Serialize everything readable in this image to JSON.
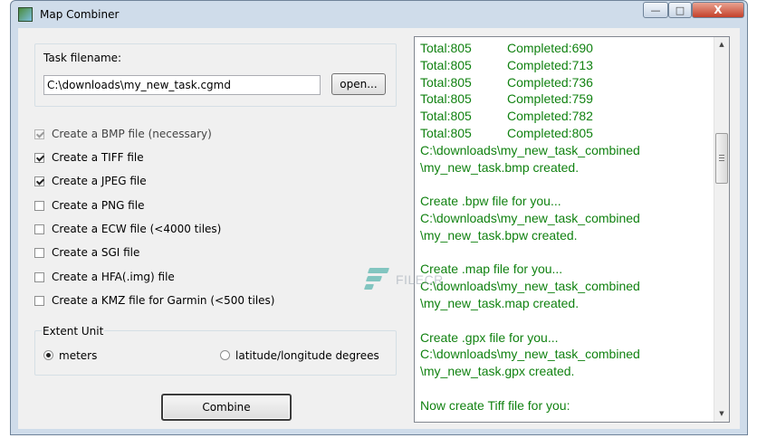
{
  "window": {
    "title": "Map Combiner",
    "controls": {
      "minimize": "—",
      "maximize": "□",
      "close": "X"
    }
  },
  "task": {
    "label": "Task filename:",
    "value": "C:\\downloads\\my_new_task.cgmd",
    "open_label": "open..."
  },
  "options": [
    {
      "label": "Create a BMP file (necessary)",
      "checked": true,
      "disabled": true
    },
    {
      "label": "Create a  TIFF file",
      "checked": true,
      "disabled": false
    },
    {
      "label": "Create a  JPEG file",
      "checked": true,
      "disabled": false
    },
    {
      "label": "Create a  PNG file",
      "checked": false,
      "disabled": false
    },
    {
      "label": "Create a  ECW file  (<4000 tiles)",
      "checked": false,
      "disabled": false
    },
    {
      "label": "Create a  SGI file",
      "checked": false,
      "disabled": false
    },
    {
      "label": "Create a  HFA(.img) file",
      "checked": false,
      "disabled": false
    },
    {
      "label": "Create a  KMZ file  for Garmin (<500 tiles)",
      "checked": false,
      "disabled": false
    }
  ],
  "extent": {
    "label": "Extent Unit",
    "meters": "meters",
    "latlon": "latitude/longitude degrees",
    "selected": "meters"
  },
  "combine_label": "Combine",
  "log": {
    "lines": [
      {
        "total": "Total:805",
        "completed": "Completed:690"
      },
      {
        "total": "Total:805",
        "completed": "Completed:713"
      },
      {
        "total": "Total:805",
        "completed": "Completed:736"
      },
      {
        "total": "Total:805",
        "completed": "Completed:759"
      },
      {
        "total": "Total:805",
        "completed": "Completed:782"
      },
      {
        "total": "Total:805",
        "completed": "Completed:805"
      },
      {
        "text": "C:\\downloads\\my_new_task_combined"
      },
      {
        "text": "\\my_new_task.bmp created."
      },
      {
        "text": ""
      },
      {
        "text": "Create .bpw file for you..."
      },
      {
        "text": "C:\\downloads\\my_new_task_combined"
      },
      {
        "text": "\\my_new_task.bpw created."
      },
      {
        "text": ""
      },
      {
        "text": "Create .map file for you..."
      },
      {
        "text": "C:\\downloads\\my_new_task_combined"
      },
      {
        "text": "\\my_new_task.map created."
      },
      {
        "text": ""
      },
      {
        "text": "Create .gpx file for you..."
      },
      {
        "text": "C:\\downloads\\my_new_task_combined"
      },
      {
        "text": "\\my_new_task.gpx created."
      },
      {
        "text": ""
      },
      {
        "text": "Now create Tiff file for you:"
      }
    ],
    "color": "#118211"
  },
  "watermark": {
    "text": "FILECR"
  }
}
